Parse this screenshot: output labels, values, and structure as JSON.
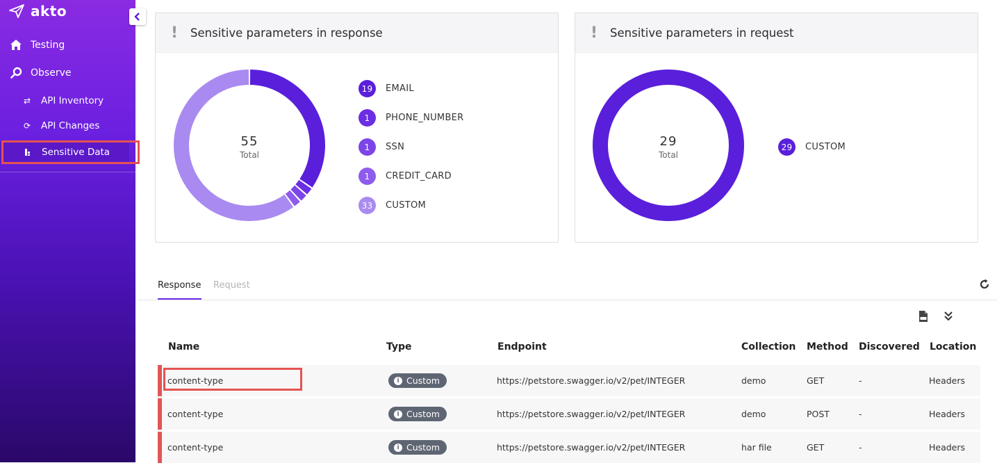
{
  "sidebar": {
    "logo_text": "akto",
    "items": [
      {
        "label": "Testing",
        "icon": "home-icon"
      },
      {
        "label": "Observe",
        "icon": "search-icon"
      },
      {
        "label": "API Inventory",
        "icon": "swap-icon"
      },
      {
        "label": "API Changes",
        "icon": "refresh-icon"
      },
      {
        "label": "Sensitive Data",
        "icon": "sensitive-data-icon"
      }
    ]
  },
  "response_card": {
    "title": "Sensitive parameters in response",
    "total": "55",
    "total_label": "Total",
    "legend": [
      {
        "count": "19",
        "label": "EMAIL",
        "color": "#5a1fdb"
      },
      {
        "count": "1",
        "label": "PHONE_NUMBER",
        "color": "#6b2ee3"
      },
      {
        "count": "1",
        "label": "SSN",
        "color": "#7c45e8"
      },
      {
        "count": "1",
        "label": "CREDIT_CARD",
        "color": "#8e5cec"
      },
      {
        "count": "33",
        "label": "CUSTOM",
        "color": "#a98af0"
      }
    ]
  },
  "request_card": {
    "title": "Sensitive parameters in request",
    "total": "29",
    "total_label": "Total",
    "legend": [
      {
        "count": "29",
        "label": "CUSTOM",
        "color": "#5a1fdb"
      }
    ]
  },
  "tabs": [
    {
      "label": "Response",
      "active": true
    },
    {
      "label": "Request",
      "active": false
    }
  ],
  "table": {
    "headers": [
      "Name",
      "Type",
      "Endpoint",
      "Collection",
      "Method",
      "Discovered",
      "Location"
    ],
    "rows": [
      {
        "name": "content-type",
        "type": "Custom",
        "endpoint": "https://petstore.swagger.io/v2/pet/INTEGER",
        "collection": "demo",
        "method": "GET",
        "discovered": "-",
        "location": "Headers"
      },
      {
        "name": "content-type",
        "type": "Custom",
        "endpoint": "https://petstore.swagger.io/v2/pet/INTEGER",
        "collection": "demo",
        "method": "POST",
        "discovered": "-",
        "location": "Headers"
      },
      {
        "name": "content-type",
        "type": "Custom",
        "endpoint": "https://petstore.swagger.io/v2/pet/INTEGER",
        "collection": "har file",
        "method": "GET",
        "discovered": "-",
        "location": "Headers"
      }
    ]
  },
  "colors": {
    "accent": "#6a2ae6",
    "highlight": "#e55252"
  }
}
